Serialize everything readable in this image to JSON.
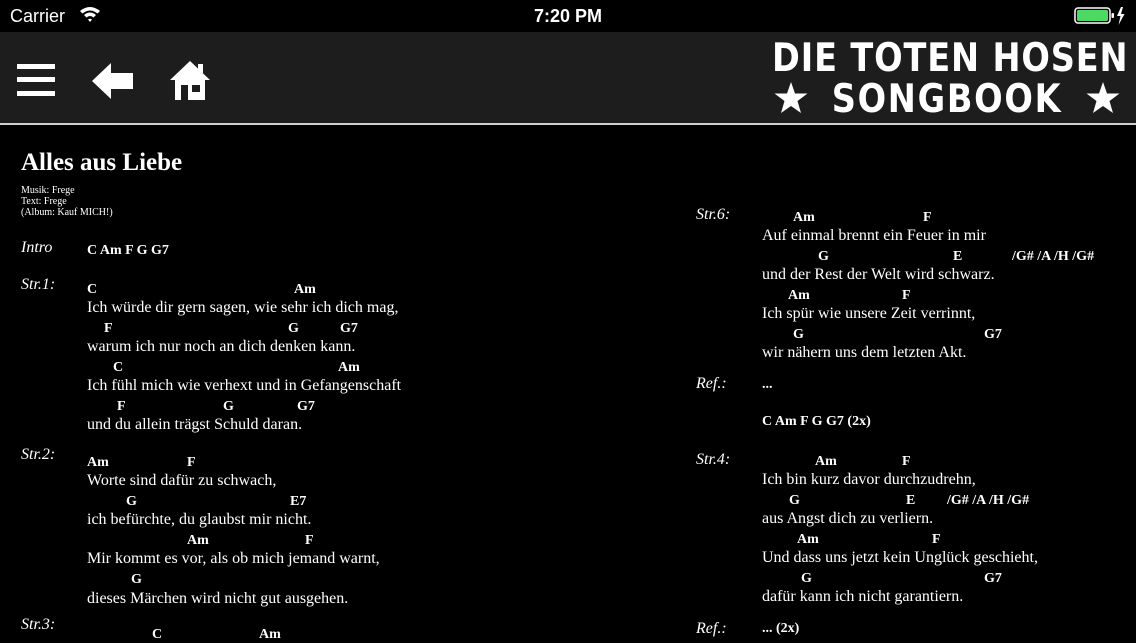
{
  "status_bar": {
    "carrier": "Carrier",
    "time": "7:20 PM"
  },
  "nav": {
    "menu_icon": "hamburger-menu-icon",
    "back_icon": "back-arrow-icon",
    "home_icon": "home-icon"
  },
  "logo": {
    "line1": "DIE TOTEN HOSEN",
    "line2": "SONGBOOK"
  },
  "song": {
    "title": "Alles aus Liebe",
    "musik": "Musik: Frege",
    "text": "Text: Frege",
    "album": "(Album: Kauf MICH!)"
  },
  "left": {
    "intro_label": "Intro",
    "intro_chords": "C Am F G G7",
    "str1_label": "Str.1:",
    "str1": {
      "c1a": "C",
      "c1b": "Am",
      "l1": "Ich würde dir gern sagen, wie sehr ich dich mag,",
      "c2a": "F",
      "c2b": "G",
      "c2c": "G7",
      "l2": "warum ich nur noch an dich denken kann.",
      "c3a": "C",
      "c3b": "Am",
      "l3": "Ich fühl mich wie verhext und in Gefangenschaft",
      "c4a": "F",
      "c4b": "G",
      "c4c": "G7",
      "l4": "und du allein trägst Schuld daran."
    },
    "str2_label": "Str.2:",
    "str2": {
      "c1a": "Am",
      "c1b": "F",
      "l1": "Worte sind dafür zu schwach,",
      "c2a": "G",
      "c2b": "E7",
      "l2": "ich befürchte, du glaubst mir nicht.",
      "c3a": "Am",
      "c3b": "F",
      "l3": "Mir kommt es vor, als ob mich jemand warnt,",
      "c4a": "G",
      "l4": "dieses Märchen wird nicht gut ausgehen."
    },
    "str3_label": "Str.3:",
    "str3": {
      "c1a": "C",
      "c1b": "Am"
    }
  },
  "right": {
    "str6_label": "Str.6:",
    "str6": {
      "c1a": "Am",
      "c1b": "F",
      "l1": "Auf einmal brennt ein Feuer in mir",
      "c2a": "G",
      "c2b": "E",
      "c2c": "/G# /A /H /G#",
      "l2": "und der Rest der Welt wird schwarz.",
      "c3a": "Am",
      "c3b": "F",
      "l3": "Ich spür wie unsere Zeit verrinnt,",
      "c4a": "G",
      "c4b": "G7",
      "l4": "wir nähern uns dem letzten Akt."
    },
    "ref_label": "Ref.:",
    "ref_text": "...",
    "ref_chords": "C Am F G G7  (2x)",
    "str4_label": "Str.4:",
    "str4": {
      "c1a": "Am",
      "c1b": "F",
      "l1": "Ich bin kurz davor durchzudrehn,",
      "c2a": "G",
      "c2b": "E",
      "c2c": "/G# /A /H /G#",
      "l2": "aus Angst dich zu verliern.",
      "c3a": "Am",
      "c3b": "F",
      "l3": "Und dass uns jetzt kein Unglück geschieht,",
      "c4a": "G",
      "c4b": "G7",
      "l4": "dafür kann ich nicht garantiern."
    },
    "ref2_label": "Ref.:",
    "ref2_text": "... (2x)"
  }
}
